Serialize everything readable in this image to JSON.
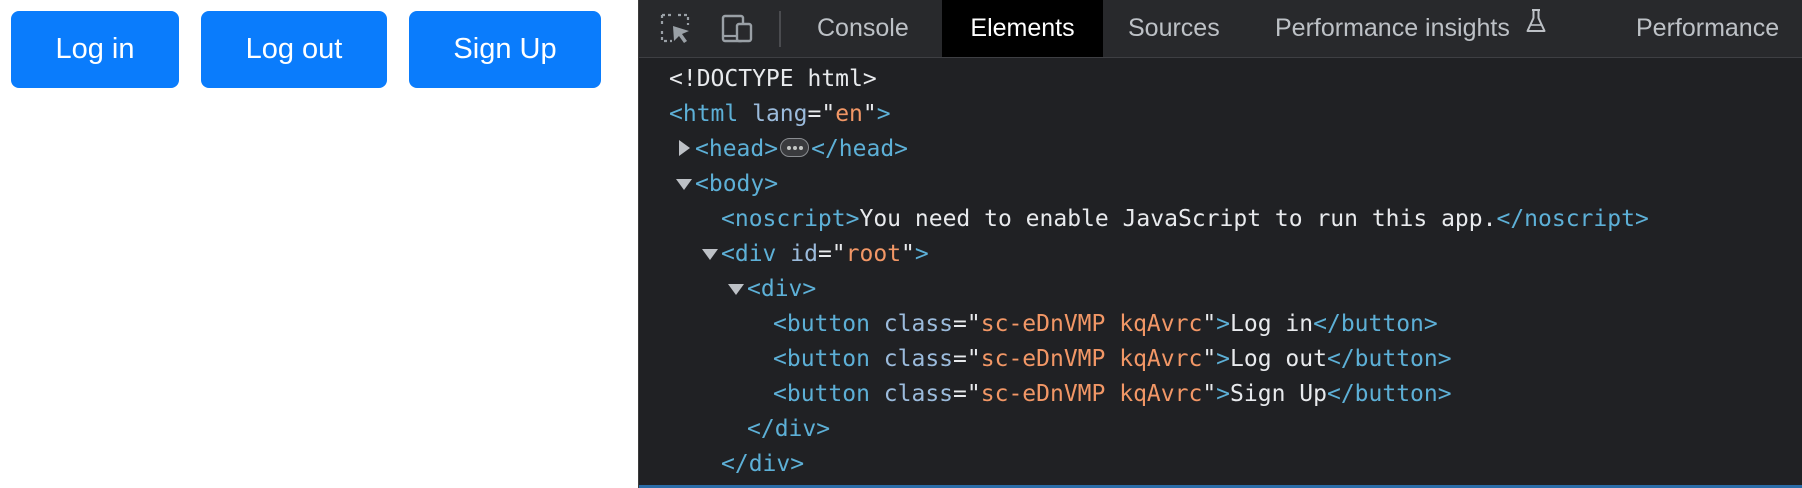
{
  "app": {
    "buttons": [
      {
        "label": "Log in"
      },
      {
        "label": "Log out"
      },
      {
        "label": "Sign Up"
      }
    ],
    "button_color": "#0a7cfc"
  },
  "devtools": {
    "tools": [
      "inspect-element-icon",
      "device-toolbar-icon"
    ],
    "tabs": {
      "console": "Console",
      "elements": "Elements",
      "sources": "Sources",
      "performance_insights": "Performance insights",
      "performance": "Performance"
    },
    "active_tab": "Elements",
    "dom": {
      "doctype": "<!DOCTYPE html>",
      "html_open": "<html",
      "html_attr": "lang",
      "html_attr_value": "en",
      "head_open": "<head>",
      "head_close": "</head>",
      "body_open": "<body>",
      "noscript_open": "<noscript>",
      "noscript_text": "You need to enable JavaScript to run this app.",
      "noscript_close": "</noscript>",
      "div_open": "<div",
      "div_attr": "id",
      "div_attr_value": "root",
      "inner_div_open": "<div>",
      "button_open": "<button",
      "button_attr": "class",
      "button_class_value": "sc-eDnVMP kqAvrc",
      "button_close": "</button>",
      "button_texts": [
        "Log in",
        "Log out",
        "Sign Up"
      ],
      "inner_div_close": "</div>",
      "root_div_close": "</div>"
    }
  }
}
